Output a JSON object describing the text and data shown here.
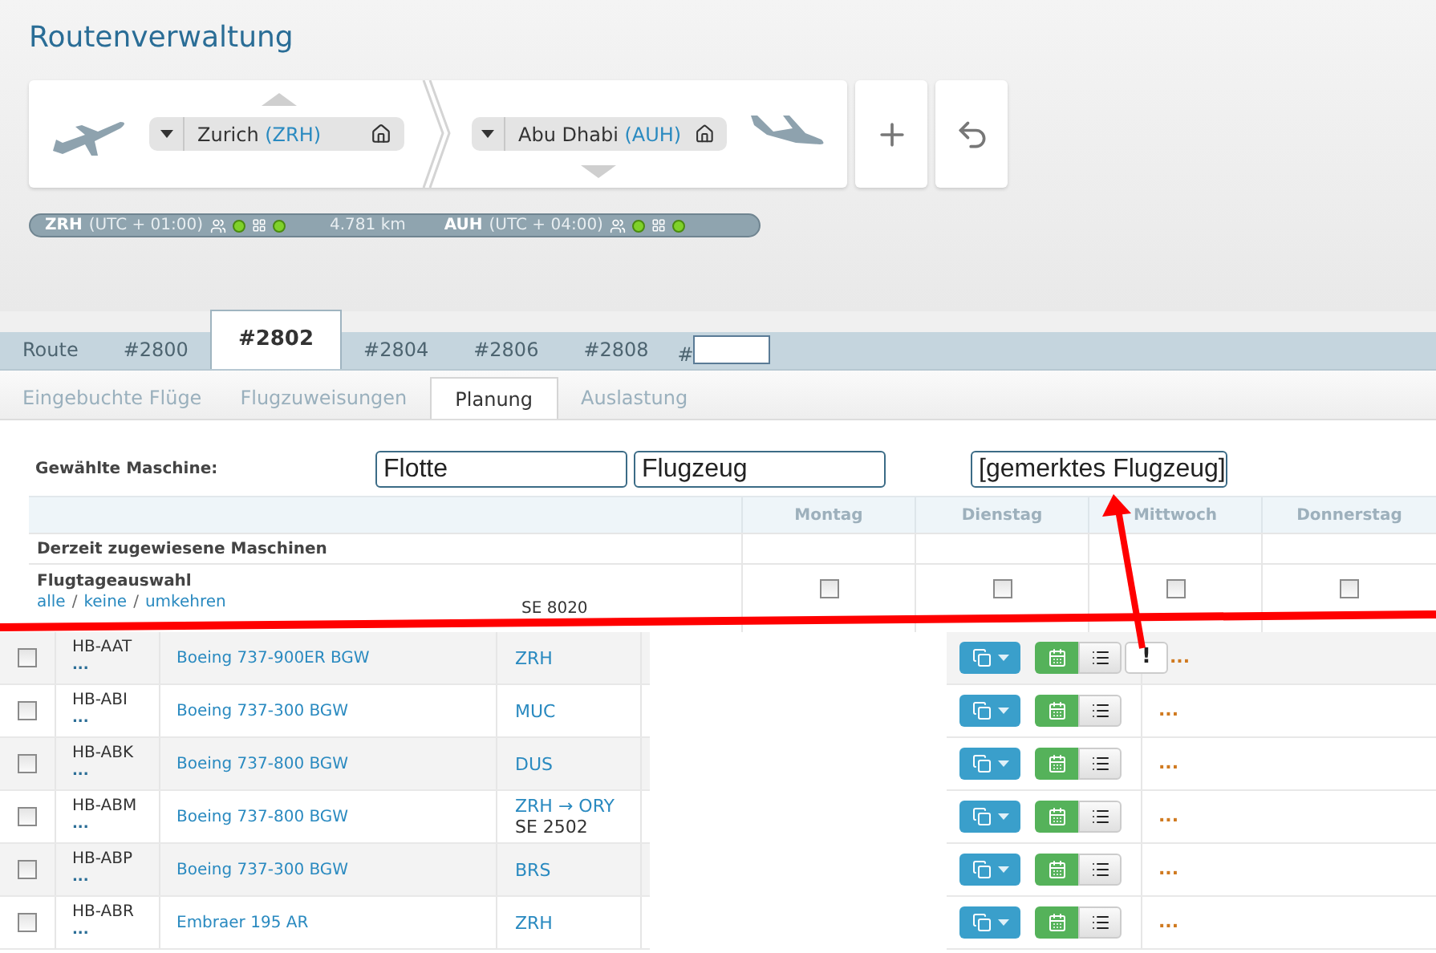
{
  "title": "Routenverwaltung",
  "route": {
    "origin": {
      "name": "Zurich",
      "code": "(ZRH)"
    },
    "destination": {
      "name": "Abu Dhabi",
      "code": "(AUH)"
    }
  },
  "status": {
    "origin": {
      "code": "ZRH",
      "tz": "(UTC + 01:00)"
    },
    "distance": "4.781 km",
    "destination": {
      "code": "AUH",
      "tz": "(UTC + 04:00)"
    }
  },
  "tabs": [
    {
      "label": "Route",
      "selected": false
    },
    {
      "label": "#2800",
      "selected": false
    },
    {
      "label": "#2802",
      "selected": true
    },
    {
      "label": "#2804",
      "selected": false
    },
    {
      "label": "#2806",
      "selected": false
    },
    {
      "label": "#2808",
      "selected": false
    }
  ],
  "tab_jump": {
    "prefix": "#"
  },
  "subtabs": [
    {
      "label": "Eingebuchte Flüge",
      "selected": false
    },
    {
      "label": "Flugzuweisungen",
      "selected": false
    },
    {
      "label": "Planung",
      "selected": true
    },
    {
      "label": "Auslastung",
      "selected": false
    }
  ],
  "machine": {
    "label": "Gewählte Maschine:",
    "fields": [
      {
        "value": "Flotte"
      },
      {
        "value": "Flugzeug"
      },
      {
        "value": "[gemerktes Flugzeug]"
      }
    ]
  },
  "days": [
    "Montag",
    "Dienstag",
    "Mittwoch",
    "Donnerstag"
  ],
  "assigned_label": "Derzeit zugewiesene Maschinen",
  "day_select": {
    "label": "Flugtageauswahl",
    "links": [
      "alle",
      "keine",
      "umkehren"
    ],
    "separator": "/",
    "checks": [
      false,
      false,
      false,
      false
    ]
  },
  "peek_flight": "SE 8020",
  "aircraft": [
    {
      "reg": "HB-AAT",
      "more": "...",
      "type": "Boeing 737-900ER BGW",
      "route": "ZRH",
      "checked": false,
      "warning": true,
      "dots": "..."
    },
    {
      "reg": "HB-ABI",
      "more": "...",
      "type": "Boeing 737-300 BGW",
      "route": "MUC",
      "checked": false,
      "warning": false,
      "dots": "..."
    },
    {
      "reg": "HB-ABK",
      "more": "...",
      "type": "Boeing 737-800 BGW",
      "route": "DUS",
      "checked": false,
      "warning": false,
      "dots": "..."
    },
    {
      "reg": "HB-ABM",
      "more": "...",
      "type": "Boeing 737-800 BGW",
      "route": "ZRH → ORY",
      "flight": "SE 2502",
      "checked": false,
      "warning": false,
      "dots": "..."
    },
    {
      "reg": "HB-ABP",
      "more": "...",
      "type": "Boeing 737-300 BGW",
      "route": "BRS",
      "checked": false,
      "warning": false,
      "dots": "..."
    },
    {
      "reg": "HB-ABR",
      "more": "...",
      "type": "Embraer 195 AR",
      "route": "ZRH",
      "checked": false,
      "warning": false,
      "dots": "..."
    }
  ],
  "warning_mark": "!"
}
